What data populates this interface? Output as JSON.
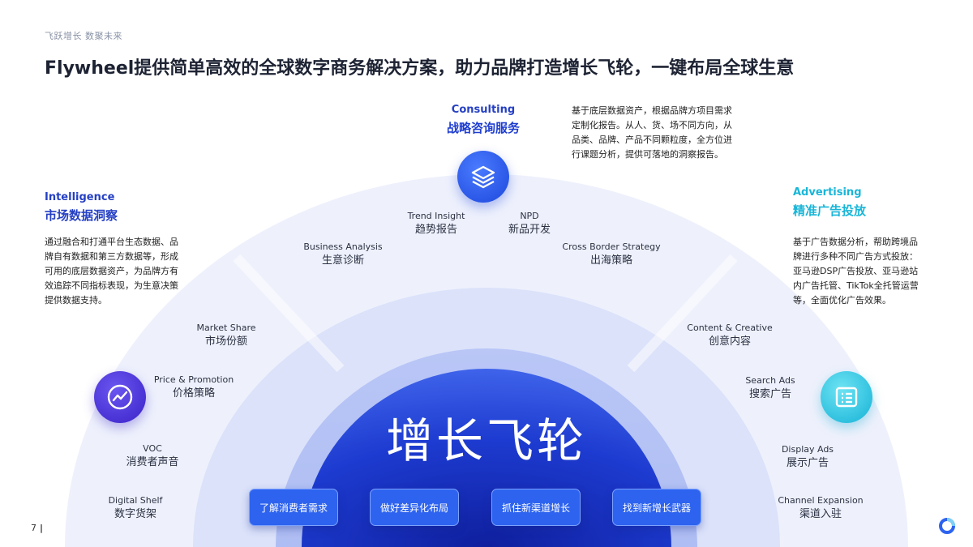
{
  "header": {
    "tagline": "飞跃增长 数聚未来",
    "title": "Flywheel提供简单高效的全球数字商务解决方案，助力品牌打造增长飞轮，一键布局全球生意"
  },
  "colors": {
    "intelligence_accent": "#2540c4",
    "consulting_accent": "#1f45d6",
    "advertising_accent": "#19b6d8",
    "core_blue": "#1e3fd0",
    "pill_blue": "#2d63ef"
  },
  "sections": {
    "consulting": {
      "en": "Consulting",
      "zh": "战略咨询服务",
      "icon": "layers-icon",
      "description": [
        "基于底层数据资产，根据品牌方项目需求",
        "定制化报告。从人、货、场不同方向，从",
        "品类、品牌、产品不同颗粒度，全方位进",
        "行课题分析，提供可落地的洞察报告。"
      ]
    },
    "intelligence": {
      "en": "Intelligence",
      "zh": "市场数据洞察",
      "icon": "trend-chart-icon",
      "description": [
        "通过融合和打通平台生态数据、品",
        "牌自有数据和第三方数据等，形成",
        "可用的底层数据资产，为品牌方有",
        "效追踪不同指标表现，为生意决策",
        "提供数据支持。"
      ]
    },
    "advertising": {
      "en": "Advertising",
      "zh": "精准广告投放",
      "icon": "document-list-icon",
      "description": [
        "基于广告数据分析，帮助跨境品",
        "牌进行多种不同广告方式投放：",
        "亚马逊DSP广告投放、亚马逊站",
        "内广告托管、TikTok全托管运营",
        "等，全面优化广告效果。"
      ]
    }
  },
  "wheel_items": {
    "trend": {
      "en": "Trend Insight",
      "zh": "趋势报告"
    },
    "npd": {
      "en": "NPD",
      "zh": "新品开发"
    },
    "business": {
      "en": "Business Analysis",
      "zh": "生意诊断"
    },
    "crossborder": {
      "en": "Cross Border Strategy",
      "zh": "出海策略"
    },
    "market": {
      "en": "Market Share",
      "zh": "市场份额"
    },
    "content": {
      "en": "Content & Creative",
      "zh": "创意内容"
    },
    "price": {
      "en": "Price & Promotion",
      "zh": "价格策略"
    },
    "search": {
      "en": "Search Ads",
      "zh": "搜索广告"
    },
    "voc": {
      "en": "VOC",
      "zh": "消费者声音"
    },
    "display": {
      "en": "Display Ads",
      "zh": "展示广告"
    },
    "digital": {
      "en": "Digital Shelf",
      "zh": "数字货架"
    },
    "channel": {
      "en": "Channel Expansion",
      "zh": "渠道入驻"
    }
  },
  "core": {
    "label": "增长飞轮",
    "buttons": [
      "了解消费者需求",
      "做好差异化布局",
      "抓住新渠道增长",
      "找到新增长武器"
    ]
  },
  "footer": {
    "page_number": "7"
  }
}
